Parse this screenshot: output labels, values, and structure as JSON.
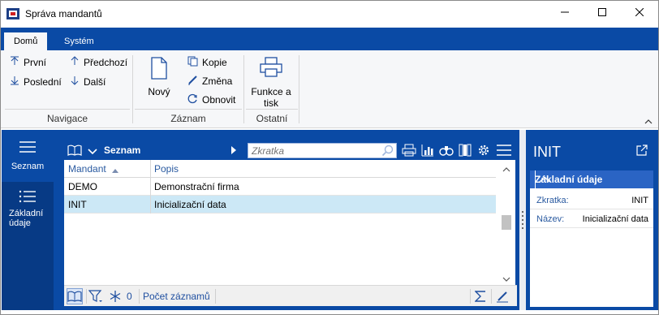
{
  "window": {
    "title": "Správa mandantů",
    "minimize_icon": "minimize-icon",
    "maximize_icon": "maximize-icon",
    "close_icon": "close-icon"
  },
  "ribbon": {
    "tabs": [
      {
        "label": "Domů",
        "active": true
      },
      {
        "label": "Systém",
        "active": false
      }
    ],
    "groups": {
      "navigace": {
        "label": "Navigace",
        "items": {
          "prvni": "První",
          "predchozi": "Předchozí",
          "posledni": "Poslední",
          "dalsi": "Další"
        }
      },
      "zaznam": {
        "label": "Záznam",
        "novy": "Nový",
        "kopie": "Kopie",
        "zmena": "Změna",
        "obnovit": "Obnovit"
      },
      "ostatni": {
        "label": "Ostatní",
        "funkce_line1": "Funkce a",
        "funkce_line2": "tisk"
      }
    }
  },
  "leftnav": {
    "items": [
      {
        "label": "Seznam",
        "icon": "menu-icon"
      },
      {
        "label_line1": "Základní",
        "label_line2": "údaje",
        "icon": "list-icon"
      }
    ]
  },
  "grid": {
    "title": "Seznam",
    "search_placeholder": "Zkratka",
    "columns": [
      "Mandant",
      "Popis"
    ],
    "rows": [
      {
        "mandant": "DEMO",
        "popis": "Demonstrační firma",
        "selected": false
      },
      {
        "mandant": "INIT",
        "popis": "Inicializační data",
        "selected": true
      }
    ],
    "footer": {
      "filter_count": "0",
      "record_count_label": "Počet záznamů"
    }
  },
  "detail": {
    "title": "INIT",
    "section_title": "Základní údaje",
    "fields": [
      {
        "label": "Zkratka:",
        "value": "INIT"
      },
      {
        "label": "Název:",
        "value": "Inicializační data"
      }
    ]
  },
  "colors": {
    "accent": "#0a4aa5",
    "selected_row": "#cce8f6",
    "ribbon_bg": "#f6f7f9"
  }
}
